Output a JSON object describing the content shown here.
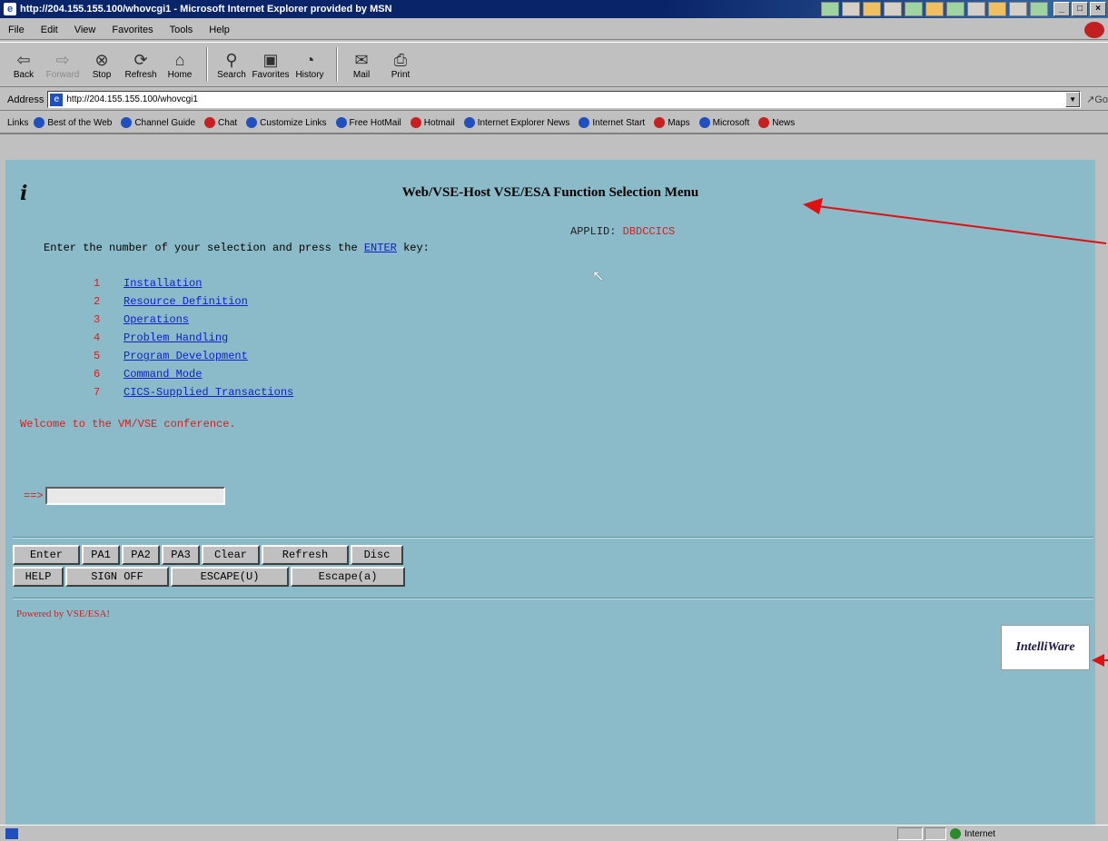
{
  "window": {
    "title": "http://204.155.155.100/whovcgi1 - Microsoft Internet Explorer provided by MSN"
  },
  "menubar": {
    "items": [
      "File",
      "Edit",
      "View",
      "Favorites",
      "Tools",
      "Help"
    ]
  },
  "toolbar": {
    "buttons": [
      {
        "label": "Back",
        "icon": "back-arrow-icon"
      },
      {
        "label": "Forward",
        "icon": "forward-arrow-icon"
      },
      {
        "label": "Stop",
        "icon": "stop-icon"
      },
      {
        "label": "Refresh",
        "icon": "refresh-icon"
      },
      {
        "label": "Home",
        "icon": "home-icon"
      },
      {
        "label": "Search",
        "icon": "search-icon"
      },
      {
        "label": "Favorites",
        "icon": "favorites-icon"
      },
      {
        "label": "History",
        "icon": "history-icon"
      },
      {
        "label": "Mail",
        "icon": "mail-icon"
      },
      {
        "label": "Print",
        "icon": "print-icon"
      }
    ]
  },
  "addressbar": {
    "label": "Address",
    "url": "http://204.155.155.100/whovcgi1",
    "go": "Go"
  },
  "links": {
    "label": "Links",
    "items": [
      {
        "label": "Best of the Web",
        "icon": "ie-page-icon"
      },
      {
        "label": "Channel Guide",
        "icon": "ie-page-icon"
      },
      {
        "label": "Chat",
        "icon": "msn-icon"
      },
      {
        "label": "Customize Links",
        "icon": "ie-page-icon"
      },
      {
        "label": "Free HotMail",
        "icon": "ie-page-icon"
      },
      {
        "label": "Hotmail",
        "icon": "msn-icon"
      },
      {
        "label": "Internet Explorer News",
        "icon": "ie-page-icon"
      },
      {
        "label": "Internet Start",
        "icon": "ie-page-icon"
      },
      {
        "label": "Maps",
        "icon": "msn-icon"
      },
      {
        "label": "Microsoft",
        "icon": "ie-page-icon"
      },
      {
        "label": "News",
        "icon": "msn-icon"
      }
    ]
  },
  "page": {
    "heading": "Web/VSE-Host VSE/ESA Function Selection Menu",
    "applid_label": "APPLID:",
    "applid_value": "DBDCCICS",
    "instruction_prefix": "Enter the number of your selection and press the",
    "instruction_link": "ENTER",
    "instruction_suffix": "key:",
    "menu": [
      {
        "num": "1",
        "label": "Installation"
      },
      {
        "num": "2",
        "label": "Resource Definition"
      },
      {
        "num": "3",
        "label": "Operations"
      },
      {
        "num": "4",
        "label": "Problem Handling"
      },
      {
        "num": "5",
        "label": "Program Development"
      },
      {
        "num": "6",
        "label": "Command Mode"
      },
      {
        "num": "7",
        "label": "CICS-Supplied Transactions"
      }
    ],
    "welcome": "Welcome to the VM/VSE conference.",
    "command_prompt": "==>",
    "command_value": "",
    "keys_row1": [
      "Enter",
      "PA1",
      "PA2",
      "PA3",
      "Clear",
      "Refresh",
      "Disc"
    ],
    "keys_row2": [
      "HELP",
      "SIGN OFF",
      "ESCAPE(U)",
      "Escape(a)"
    ],
    "powered": "Powered by VSE/ESA!",
    "logo_text": "IntelliWare"
  },
  "statusbar": {
    "zone": "Internet"
  },
  "colors": {
    "page_bg": "#8bbbc9",
    "link": "#1020d0",
    "accent_red": "#d02020",
    "annotation_arrow": "#e01010"
  }
}
